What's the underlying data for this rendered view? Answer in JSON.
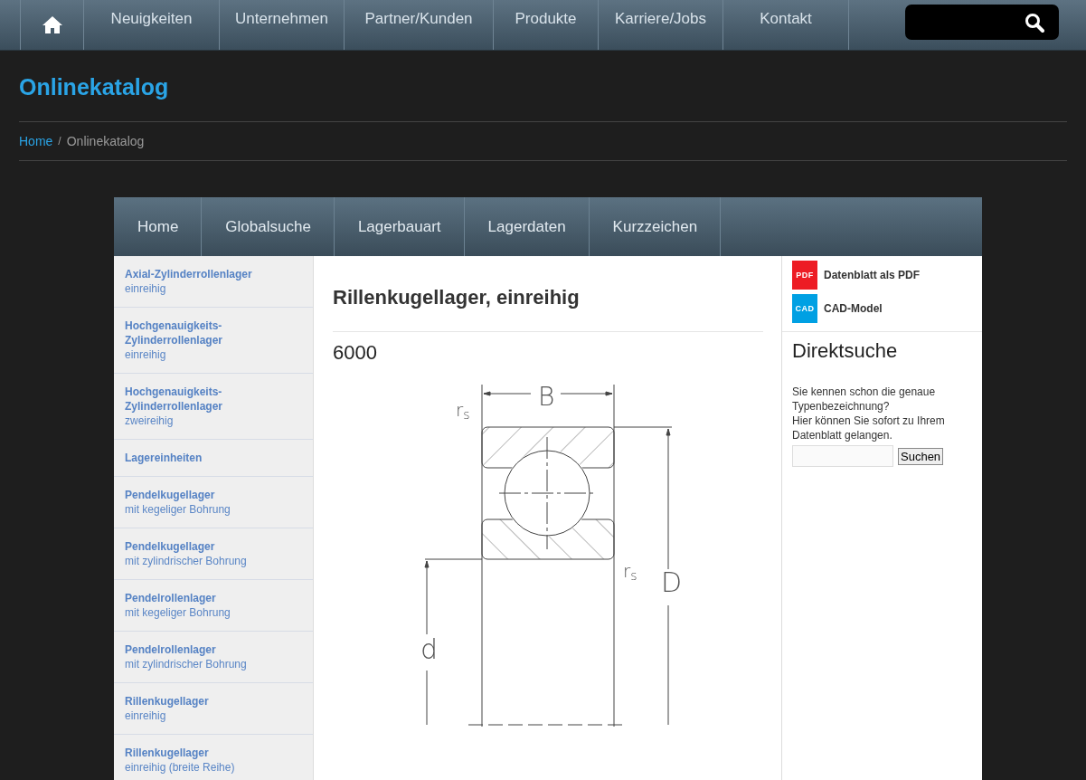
{
  "top_nav": {
    "items": [
      "Neuigkeiten",
      "Unternehmen",
      "Partner/Kunden",
      "Produkte",
      "Karriere/Jobs",
      "Kontakt"
    ]
  },
  "page_title": "Onlinekatalog",
  "breadcrumb": [
    {
      "label": "Home",
      "kind": "link"
    },
    {
      "label": "/",
      "kind": "separator"
    },
    {
      "label": "Onlinekatalog",
      "kind": "current"
    }
  ],
  "catalog_nav": [
    "Home",
    "Globalsuche",
    "Lagerbauart",
    "Lagerdaten",
    "Kurzzeichen"
  ],
  "sidebar": {
    "items": [
      {
        "title": "Axial-Zylinderrollenlager",
        "subtitle": "einreihig"
      },
      {
        "title": "Hochgenauigkeits-Zylinderrollenlager",
        "subtitle": "einreihig"
      },
      {
        "title": "Hochgenauigkeits-Zylinderrollenlager",
        "subtitle": "zweireihig"
      },
      {
        "title": "Lagereinheiten"
      },
      {
        "title": "Pendelkugellager",
        "subtitle": "mit kegeliger Bohrung"
      },
      {
        "title": "Pendelkugellager",
        "subtitle": "mit zylindrischer Bohrung"
      },
      {
        "title": "Pendelrollenlager",
        "subtitle": "mit kegeliger Bohrung"
      },
      {
        "title": "Pendelrollenlager",
        "subtitle": "mit zylindrischer Bohrung"
      },
      {
        "title": "Rillenkugellager",
        "subtitle": "einreihig"
      },
      {
        "title": "Rillenkugellager",
        "subtitle": "einreihig (breite Reihe)"
      }
    ]
  },
  "product": {
    "title": "Rillenkugellager, einreihig",
    "designation": "6000",
    "drawing_labels": {
      "width": "B",
      "radius_top": "r$_{s}$",
      "radius_bottom": "r$_{s}$",
      "outer_diameter": "D",
      "bore": "d"
    }
  },
  "downloads": [
    {
      "badge": "PDF",
      "label": "Datenblatt als PDF",
      "color": "#ed1c24"
    },
    {
      "badge": "CAD",
      "label": "CAD-Model",
      "color": "#00a0e3"
    }
  ],
  "direct_search": {
    "title": "Direktsuche",
    "lines": [
      "Sie kennen schon die genaue Typenbezeichnung?",
      "Hier können Sie sofort zu Ihrem Datenblatt gelangen."
    ],
    "button": "Suchen"
  }
}
